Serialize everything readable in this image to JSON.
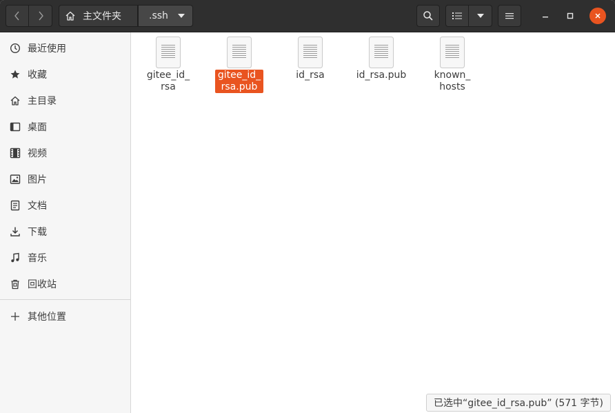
{
  "header": {
    "breadcrumb_home": "主文件夹",
    "breadcrumb_current": ".ssh"
  },
  "sidebar": {
    "items": [
      {
        "label": "最近使用",
        "icon": "clock-icon"
      },
      {
        "label": "收藏",
        "icon": "star-icon"
      },
      {
        "label": "主目录",
        "icon": "home-icon"
      },
      {
        "label": "桌面",
        "icon": "desktop-icon"
      },
      {
        "label": "视频",
        "icon": "video-icon"
      },
      {
        "label": "图片",
        "icon": "image-icon"
      },
      {
        "label": "文档",
        "icon": "document-icon"
      },
      {
        "label": "下载",
        "icon": "download-icon"
      },
      {
        "label": "音乐",
        "icon": "music-icon"
      },
      {
        "label": "回收站",
        "icon": "trash-icon"
      }
    ],
    "other_locations": "其他位置"
  },
  "files": [
    {
      "name": "gitee_id_rsa",
      "line1": "gitee_id_",
      "line2": "rsa",
      "selected": false
    },
    {
      "name": "gitee_id_rsa.pub",
      "line1": "gitee_id_",
      "line2": "rsa.pub",
      "selected": true
    },
    {
      "name": "id_rsa",
      "line1": "id_rsa",
      "line2": "",
      "selected": false
    },
    {
      "name": "id_rsa.pub",
      "line1": "id_rsa.pub",
      "line2": "",
      "selected": false
    },
    {
      "name": "known_hosts",
      "line1": "known_",
      "line2": "hosts",
      "selected": false
    }
  ],
  "status": {
    "text": "已选中“gitee_id_rsa.pub” (571 字节)"
  },
  "colors": {
    "accent": "#e95420",
    "headerbar": "#2f2f2f",
    "sidebar": "#f6f6f6"
  }
}
